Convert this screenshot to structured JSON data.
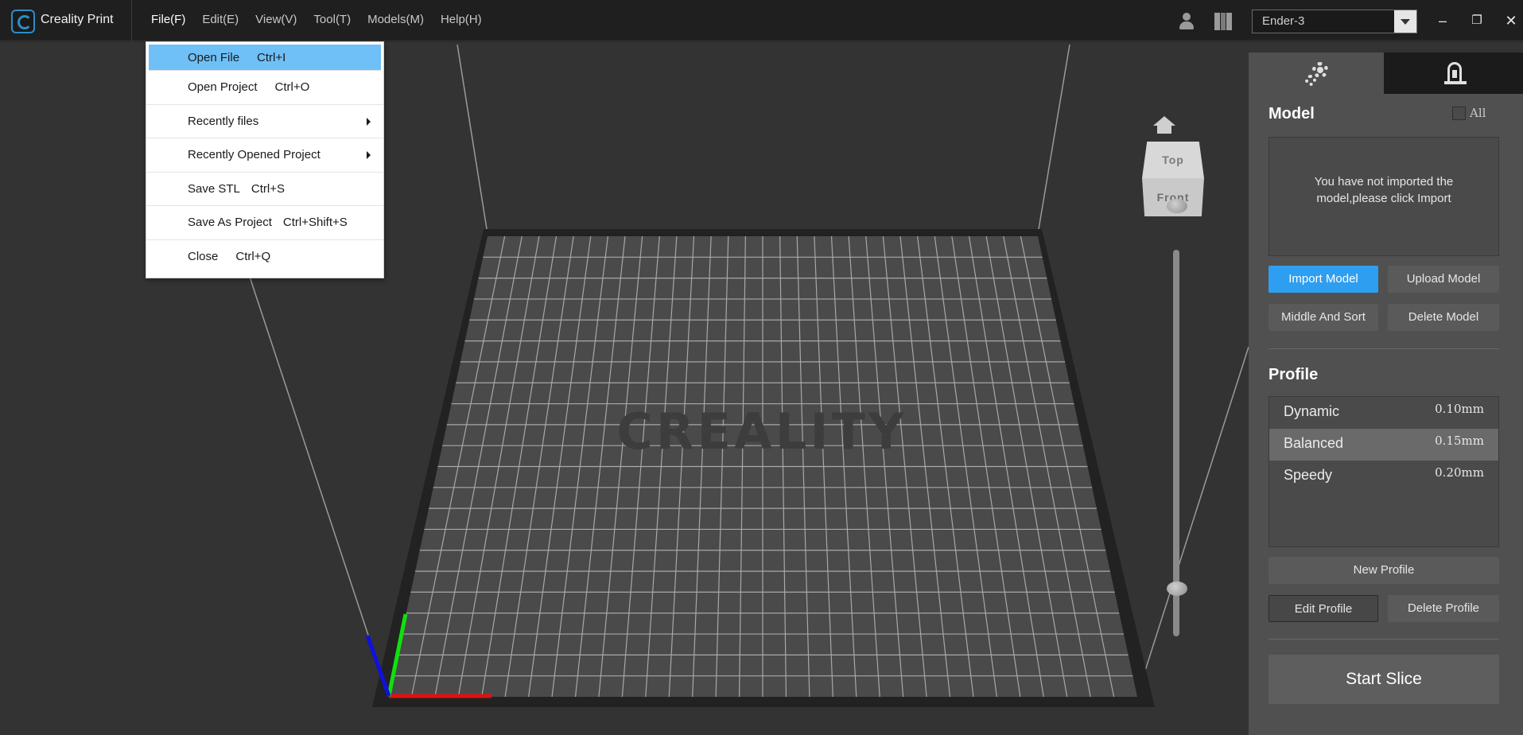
{
  "app": {
    "title": "Creality Print"
  },
  "menubar": [
    {
      "label": "File(F)"
    },
    {
      "label": "Edit(E)"
    },
    {
      "label": "View(V)"
    },
    {
      "label": "Tool(T)"
    },
    {
      "label": "Models(M)"
    },
    {
      "label": "Help(H)"
    }
  ],
  "printer": {
    "selected": "Ender-3"
  },
  "window_controls": {
    "minimize": "–",
    "restore": "❐",
    "close": "✕"
  },
  "file_menu": {
    "items": [
      {
        "label": "Open File",
        "shortcut": "Ctrl+I"
      },
      {
        "label": "Open Project",
        "shortcut": "Ctrl+O"
      },
      {
        "label": "Recently files",
        "shortcut": ""
      },
      {
        "label": "Recently Opened Project",
        "shortcut": ""
      },
      {
        "label": "Save STL",
        "shortcut": "Ctrl+S"
      },
      {
        "label": "Save As Project",
        "shortcut": "Ctrl+Shift+S"
      },
      {
        "label": "Close",
        "shortcut": "Ctrl+Q"
      }
    ]
  },
  "viewport": {
    "bed_watermark": "CREALITY",
    "view_cube": {
      "top": "Top",
      "front": "Front"
    }
  },
  "panel": {
    "model": {
      "title": "Model",
      "all_label": "All",
      "empty_message_line1": "You have not imported the",
      "empty_message_line2": "model,please click Import",
      "import_button": "Import Model",
      "upload_button": "Upload Model",
      "middle_sort_button": "Middle And Sort",
      "delete_button": "Delete Model"
    },
    "profile": {
      "title": "Profile",
      "items": [
        {
          "name": "Dynamic",
          "value": "0.10mm"
        },
        {
          "name": "Balanced",
          "value": "0.15mm"
        },
        {
          "name": "Speedy",
          "value": "0.20mm"
        }
      ],
      "new_button": "New Profile",
      "edit_button": "Edit Profile",
      "delete_button": "Delete Profile"
    },
    "start_slice": "Start Slice"
  },
  "colors": {
    "accent": "#2e9ef0",
    "menu_highlight": "#6ec0f7",
    "axis_x": "#e01010",
    "axis_y": "#10e010",
    "axis_z": "#1010e0"
  }
}
